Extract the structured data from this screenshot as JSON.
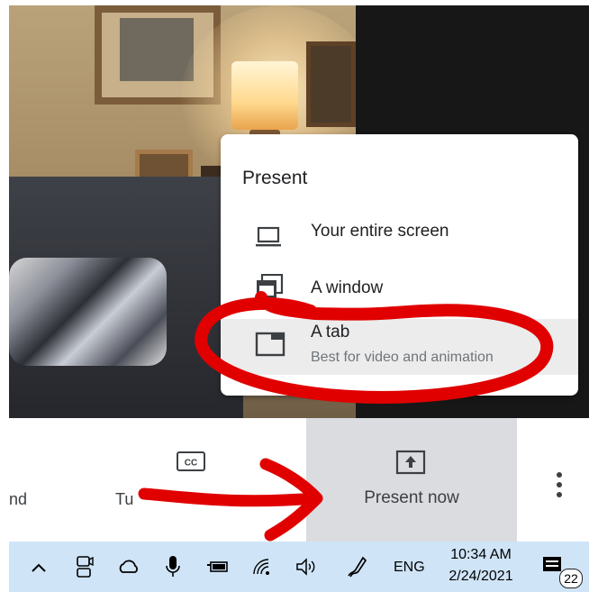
{
  "present_menu": {
    "title": "Present",
    "items": [
      {
        "label": "Your entire screen",
        "icon": "laptop-icon"
      },
      {
        "label": "A window",
        "icon": "window-icon"
      },
      {
        "label": "A tab",
        "sublabel": "Best for video and animation",
        "icon": "browser-tab-icon"
      }
    ]
  },
  "toolbar": {
    "left_text_fragment": "nd",
    "captions_text_fragment": "Tu",
    "present_now_label": "Present now",
    "present_now_icon": "present-screen-icon",
    "more_icon": "more-vert-icon"
  },
  "taskbar": {
    "language": "ENG",
    "time": "10:34 AM",
    "date": "2/24/2021",
    "notification_count": "22",
    "tray_icons": [
      "chevron-up-icon",
      "meet-now-icon",
      "onedrive-cloud-icon",
      "microphone-icon",
      "battery-icon",
      "wifi-icon",
      "volume-icon",
      "pen-icon",
      "notification-icon"
    ]
  },
  "colors": {
    "annotation_red": "#e00000",
    "taskbar_bg": "#cfe4f7",
    "present_now_bg": "#dadce0",
    "menu_selected_bg": "#ececec"
  }
}
